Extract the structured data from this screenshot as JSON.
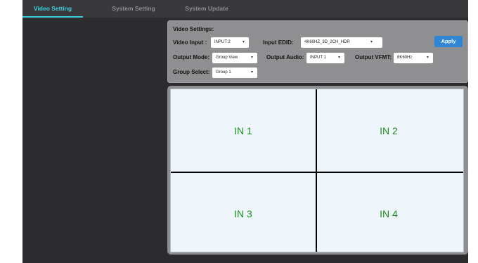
{
  "nav": {
    "tabs": [
      "Video Setting",
      "System Setting",
      "System Update"
    ],
    "active": "Video Setting"
  },
  "video_settings": {
    "title": "Video Settings:",
    "video_input": {
      "label": "Video Input :",
      "value": "INPUT 2"
    },
    "input_edid": {
      "label": "Input EDID:",
      "value": "4K60HZ_3D_2CH_HDR"
    },
    "apply_label": "Apply",
    "output_mode": {
      "label": "Output Mode:",
      "value": "Group View"
    },
    "output_audio": {
      "label": "Output Audio:",
      "value": "INPUT 1"
    },
    "output_vfmt": {
      "label": "Output VFMT:",
      "value": "8K60Hz"
    },
    "group_select": {
      "label": "Group Select:",
      "value": "Group 1"
    }
  },
  "grid": {
    "cells": [
      "IN 1",
      "IN 2",
      "IN 3",
      "IN 4"
    ]
  },
  "colors": {
    "accent": "#3fd0e0",
    "apply_button": "#2f86d6",
    "cell_text": "#1a8f1a"
  },
  "icons": {
    "dropdown": "chevron-down-icon"
  }
}
